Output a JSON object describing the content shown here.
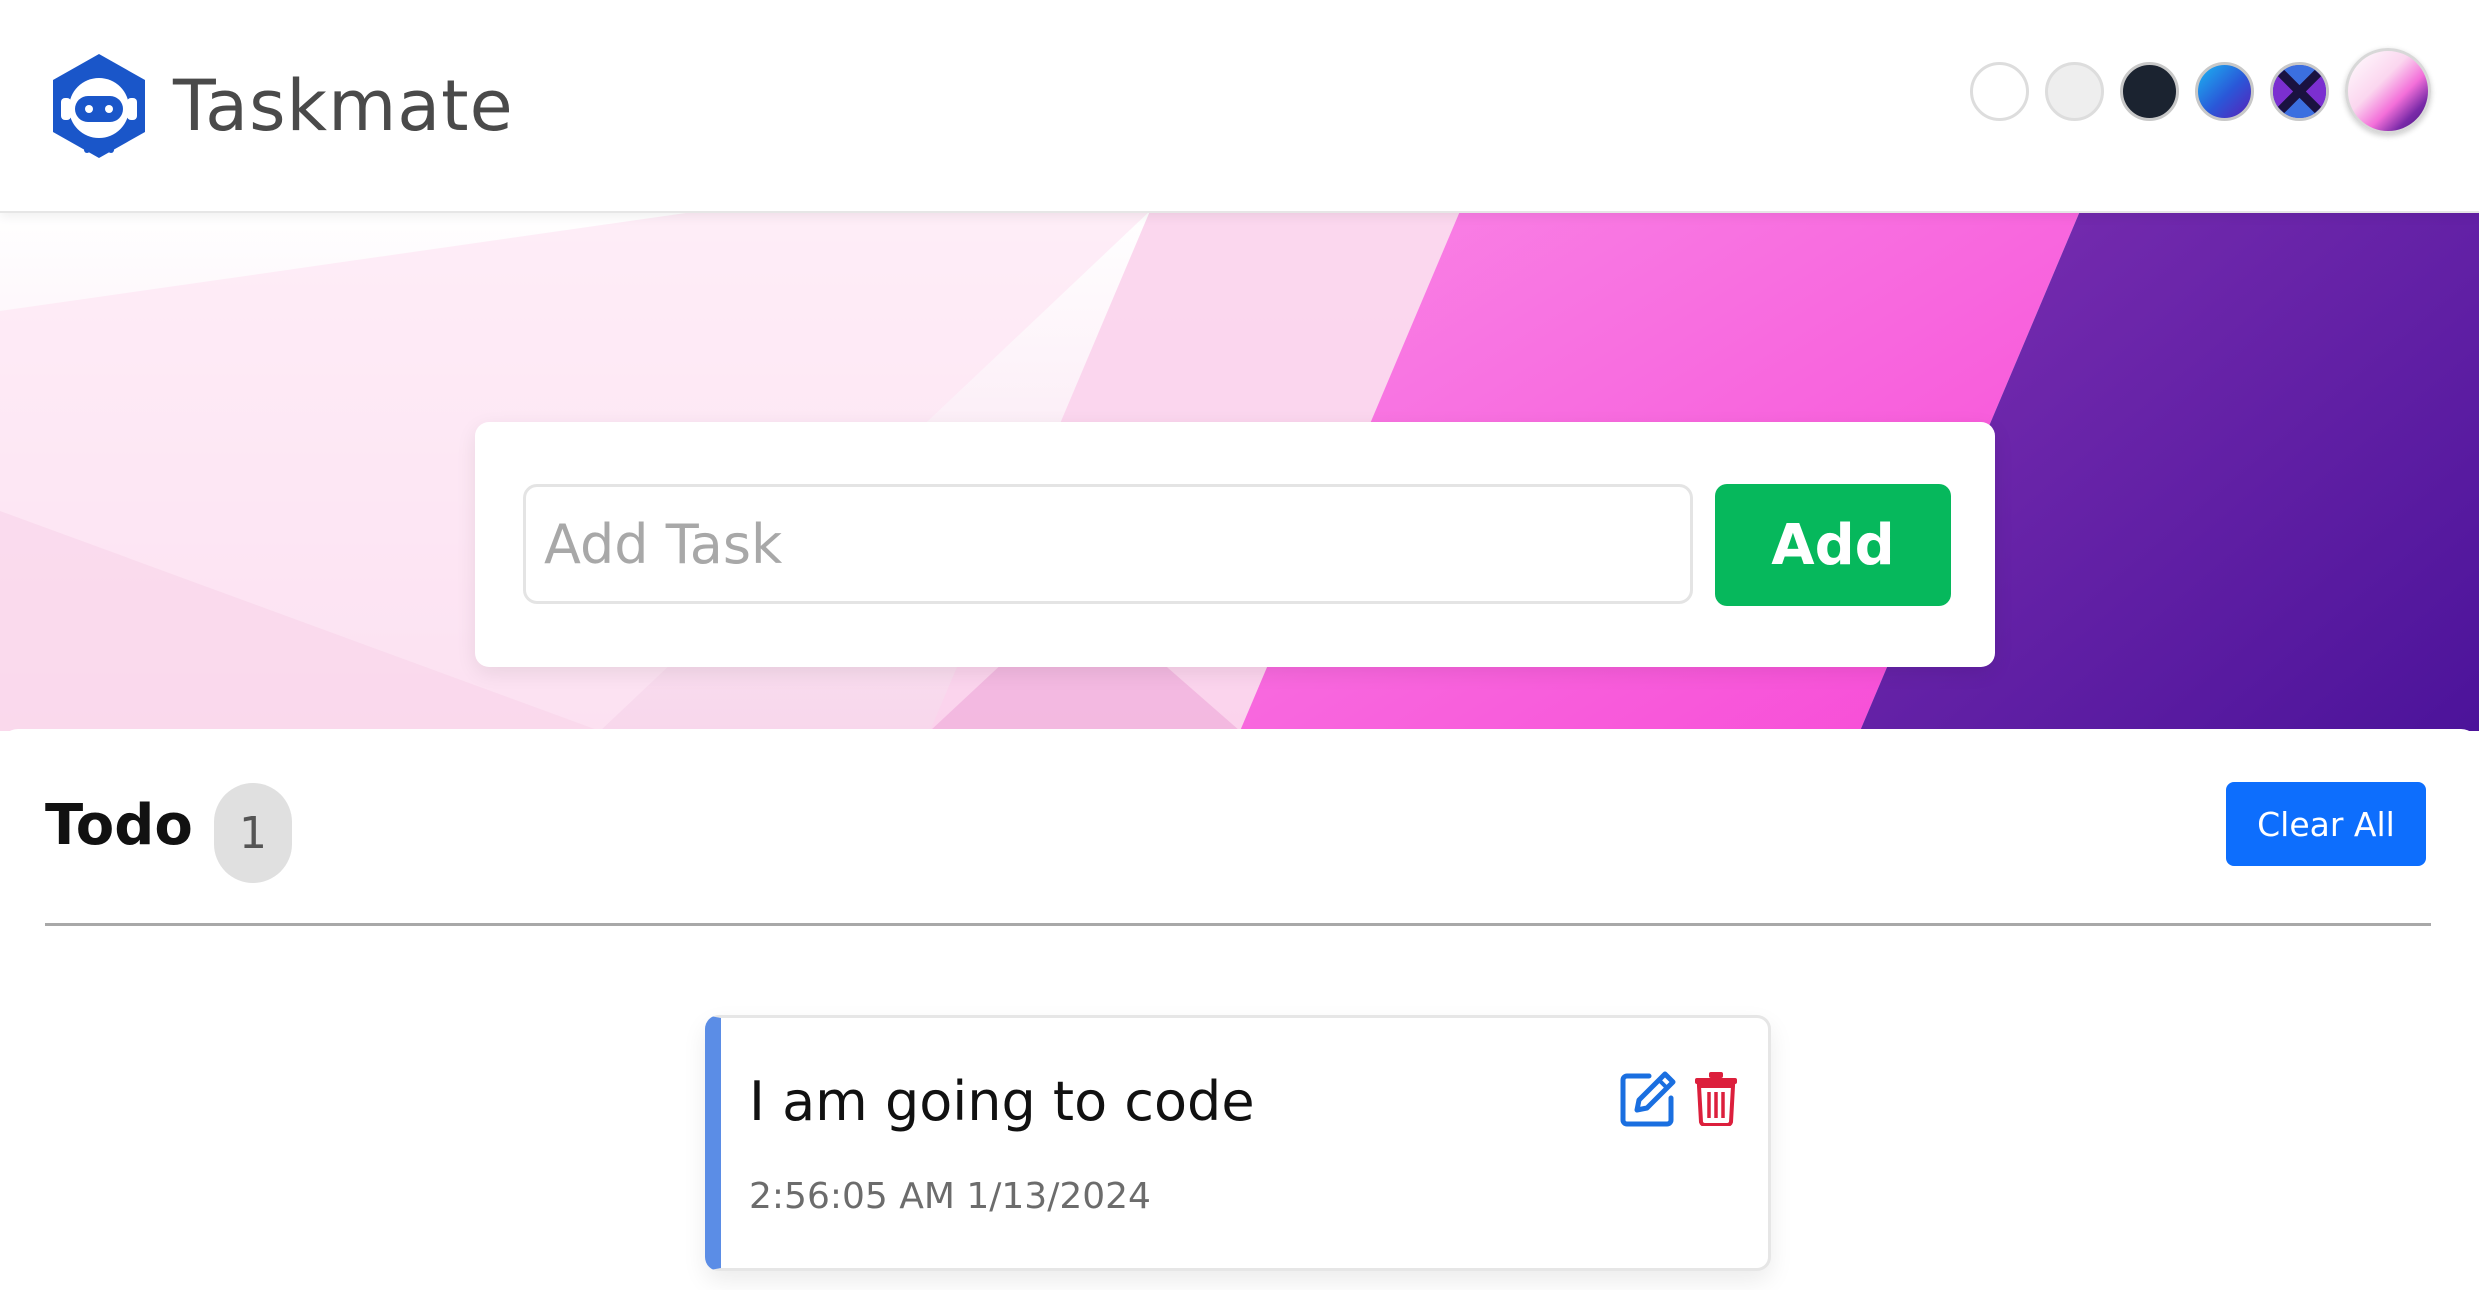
{
  "navbar": {
    "brand_name": "Taskmate",
    "logo_icon": "robot-logo-icon",
    "theme_options": [
      "light",
      "gray",
      "dark",
      "blue",
      "x-pattern",
      "pink-gradient"
    ]
  },
  "add_task": {
    "placeholder": "Add Task",
    "value": "",
    "button_label": "Add"
  },
  "todo": {
    "title": "Todo",
    "count": "1",
    "clear_label": "Clear All",
    "tasks": [
      {
        "name": "I am going to code",
        "timestamp": "2:56:05 AM 1/13/2024"
      }
    ]
  },
  "colors": {
    "add_button": "#06b85c",
    "clear_button": "#0d6efd",
    "edit_icon": "#1a6fe0",
    "delete_icon": "#dc1f3c",
    "task_accent": "#5b8de6"
  },
  "icons": {
    "edit": "edit-icon",
    "delete": "trash-icon"
  }
}
